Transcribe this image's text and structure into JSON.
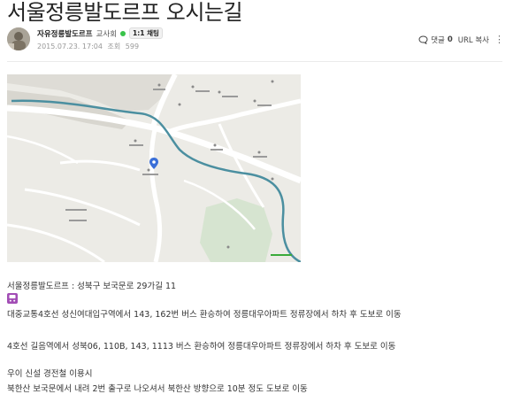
{
  "post": {
    "title": "서울정릉발도르프 오시는길",
    "author": "자유정릉발도르프",
    "role": "교사회",
    "chat_badge": "1:1 채팅",
    "date": "2015.07.23. 17:04",
    "views_label": "조회",
    "views": "599"
  },
  "actions": {
    "comment_label": "댓글",
    "comment_count": "0",
    "url_copy": "URL 복사"
  },
  "content": {
    "address": "서울정릉발도르프 : 성북구 보국문로 29가길 11",
    "line1": "대중교통4호선 성신여대입구역에서 143, 162번 버스 환승하여 정릉대우아파트 정류장에서 하차 후 도보로 이동",
    "line2": "4호선 길음역에서 성북06, 110B, 143, 1113 버스 환승하여 정릉대우아파트 정류장에서 하차 후 도보로 이동",
    "line3": "우이 신설 경전철 이용시",
    "line4": "북한산 보국문에서 내려 2번 출구로 나오셔서 북한산 방향으로 10분 정도 도보로 이동"
  },
  "icons": {
    "avatar": "avatar-photo",
    "online": "online-dot",
    "comment": "comment-icon",
    "more": "more-vertical-icon",
    "bus": "bus-emoji-icon",
    "marker": "map-marker-icon"
  },
  "colors": {
    "online": "#39c34a",
    "bus_icon": "#a24db5",
    "river": "#4b8fa0"
  }
}
